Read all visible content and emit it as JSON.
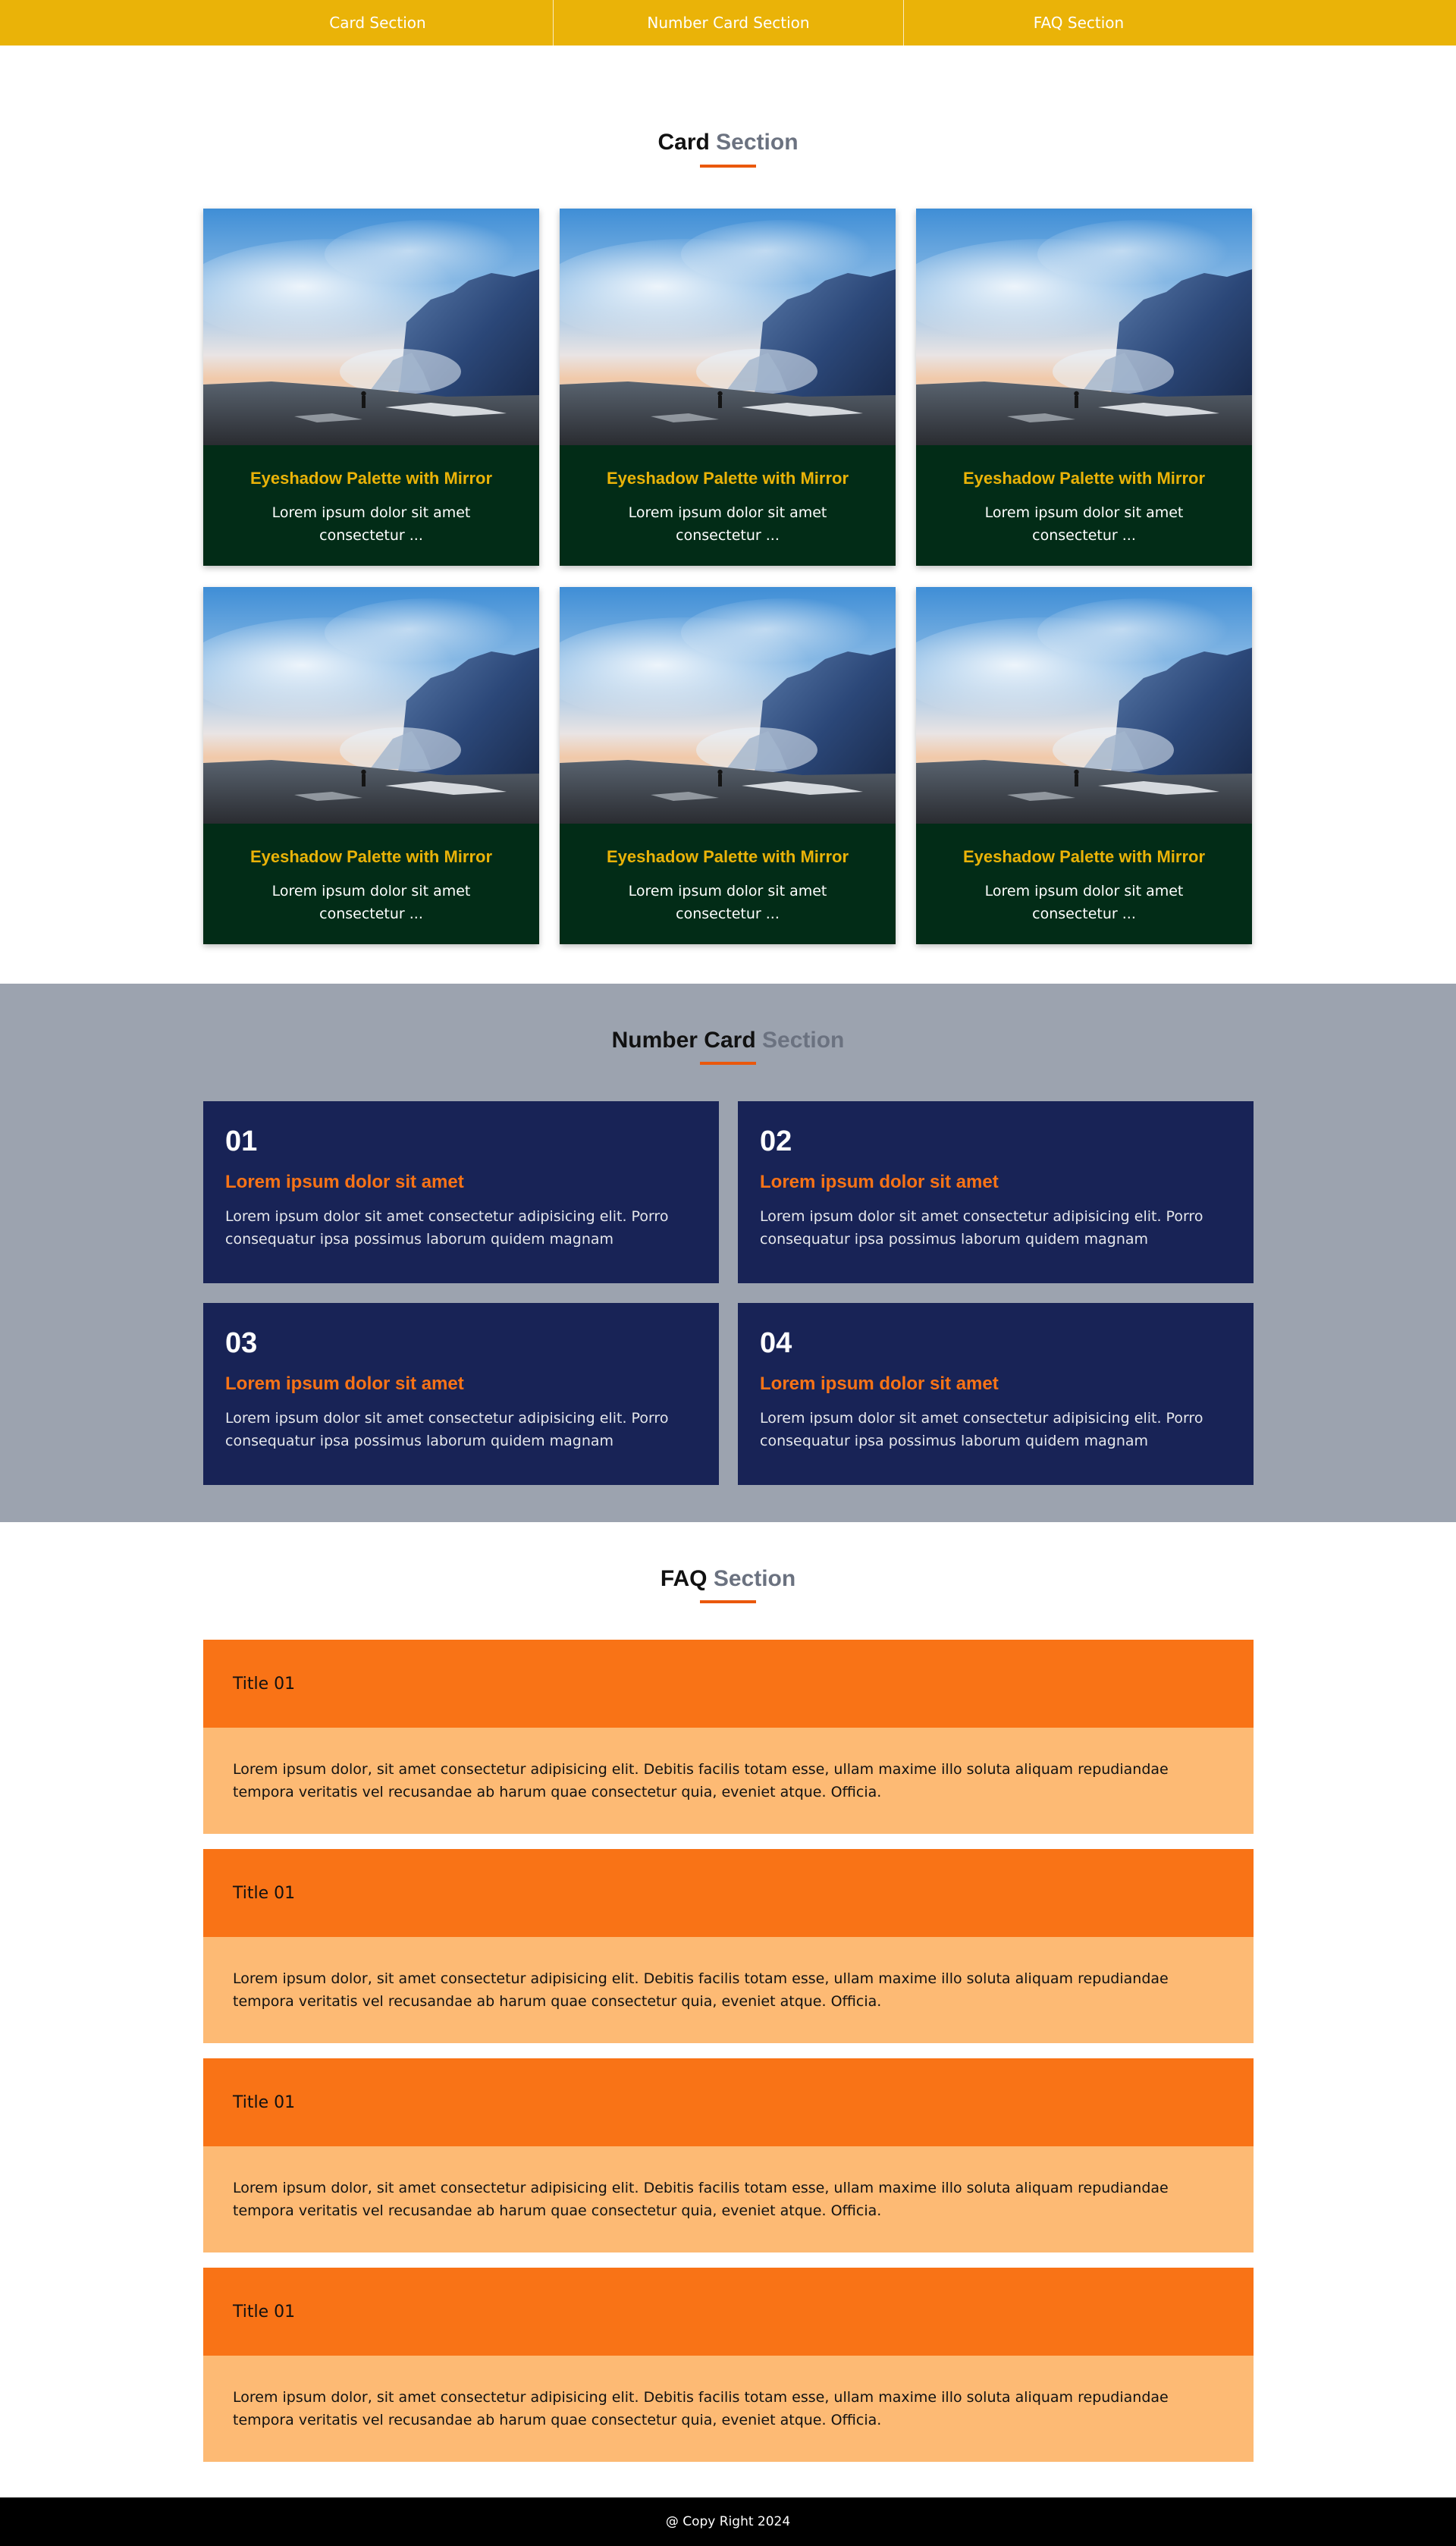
{
  "nav": {
    "links": [
      "Card Section",
      "Number Card Section",
      "FAQ Section"
    ]
  },
  "card_section": {
    "heading_main": "Card",
    "heading_accent": "Section",
    "cards": [
      {
        "title": "Eyeshadow Palette with Mirror",
        "text": "Lorem ipsum dolor sit amet consectetur ..."
      },
      {
        "title": "Eyeshadow Palette with Mirror",
        "text": "Lorem ipsum dolor sit amet consectetur ..."
      },
      {
        "title": "Eyeshadow Palette with Mirror",
        "text": "Lorem ipsum dolor sit amet consectetur ..."
      },
      {
        "title": "Eyeshadow Palette with Mirror",
        "text": "Lorem ipsum dolor sit amet consectetur ..."
      },
      {
        "title": "Eyeshadow Palette with Mirror",
        "text": "Lorem ipsum dolor sit amet consectetur ..."
      },
      {
        "title": "Eyeshadow Palette with Mirror",
        "text": "Lorem ipsum dolor sit amet consectetur ..."
      }
    ]
  },
  "number_section": {
    "heading_main": "Number Card",
    "heading_accent": "Section",
    "cards": [
      {
        "number": "01",
        "title": "Lorem ipsum dolor sit amet",
        "text": "Lorem ipsum dolor sit amet consectetur adipisicing elit. Porro consequatur ipsa possimus laborum quidem magnam"
      },
      {
        "number": "02",
        "title": "Lorem ipsum dolor sit amet",
        "text": "Lorem ipsum dolor sit amet consectetur adipisicing elit. Porro consequatur ipsa possimus laborum quidem magnam"
      },
      {
        "number": "03",
        "title": "Lorem ipsum dolor sit amet",
        "text": "Lorem ipsum dolor sit amet consectetur adipisicing elit. Porro consequatur ipsa possimus laborum quidem magnam"
      },
      {
        "number": "04",
        "title": "Lorem ipsum dolor sit amet",
        "text": "Lorem ipsum dolor sit amet consectetur adipisicing elit. Porro consequatur ipsa possimus laborum quidem magnam"
      }
    ]
  },
  "faq_section": {
    "heading_main": "FAQ",
    "heading_accent": "Section",
    "items": [
      {
        "title": "Title 01",
        "answer": "Lorem ipsum dolor, sit amet consectetur adipisicing elit. Debitis facilis totam esse, ullam maxime illo soluta aliquam repudiandae tempora veritatis vel recusandae ab harum quae consectetur quia, eveniet atque. Officia."
      },
      {
        "title": "Title 01",
        "answer": "Lorem ipsum dolor, sit amet consectetur adipisicing elit. Debitis facilis totam esse, ullam maxime illo soluta aliquam repudiandae tempora veritatis vel recusandae ab harum quae consectetur quia, eveniet atque. Officia."
      },
      {
        "title": "Title 01",
        "answer": "Lorem ipsum dolor, sit amet consectetur adipisicing elit. Debitis facilis totam esse, ullam maxime illo soluta aliquam repudiandae tempora veritatis vel recusandae ab harum quae consectetur quia, eveniet atque. Officia."
      },
      {
        "title": "Title 01",
        "answer": "Lorem ipsum dolor, sit amet consectetur adipisicing elit. Debitis facilis totam esse, ullam maxime illo soluta aliquam repudiandae tempora veritatis vel recusandae ab harum quae consectetur quia, eveniet atque. Officia."
      }
    ]
  },
  "footer": {
    "text": "@ Copy Right 2024"
  },
  "colors": {
    "nav_bg": "#eab308",
    "card_bg": "#022c17",
    "card_title": "#eab308",
    "number_section_bg": "#9ca3af",
    "number_card_bg": "#182356",
    "number_card_title": "#f97316",
    "faq_title_bg": "#f97316",
    "faq_answer_bg": "#fdba74",
    "heading_underline": "#ea580c",
    "footer_bg": "#000000"
  }
}
